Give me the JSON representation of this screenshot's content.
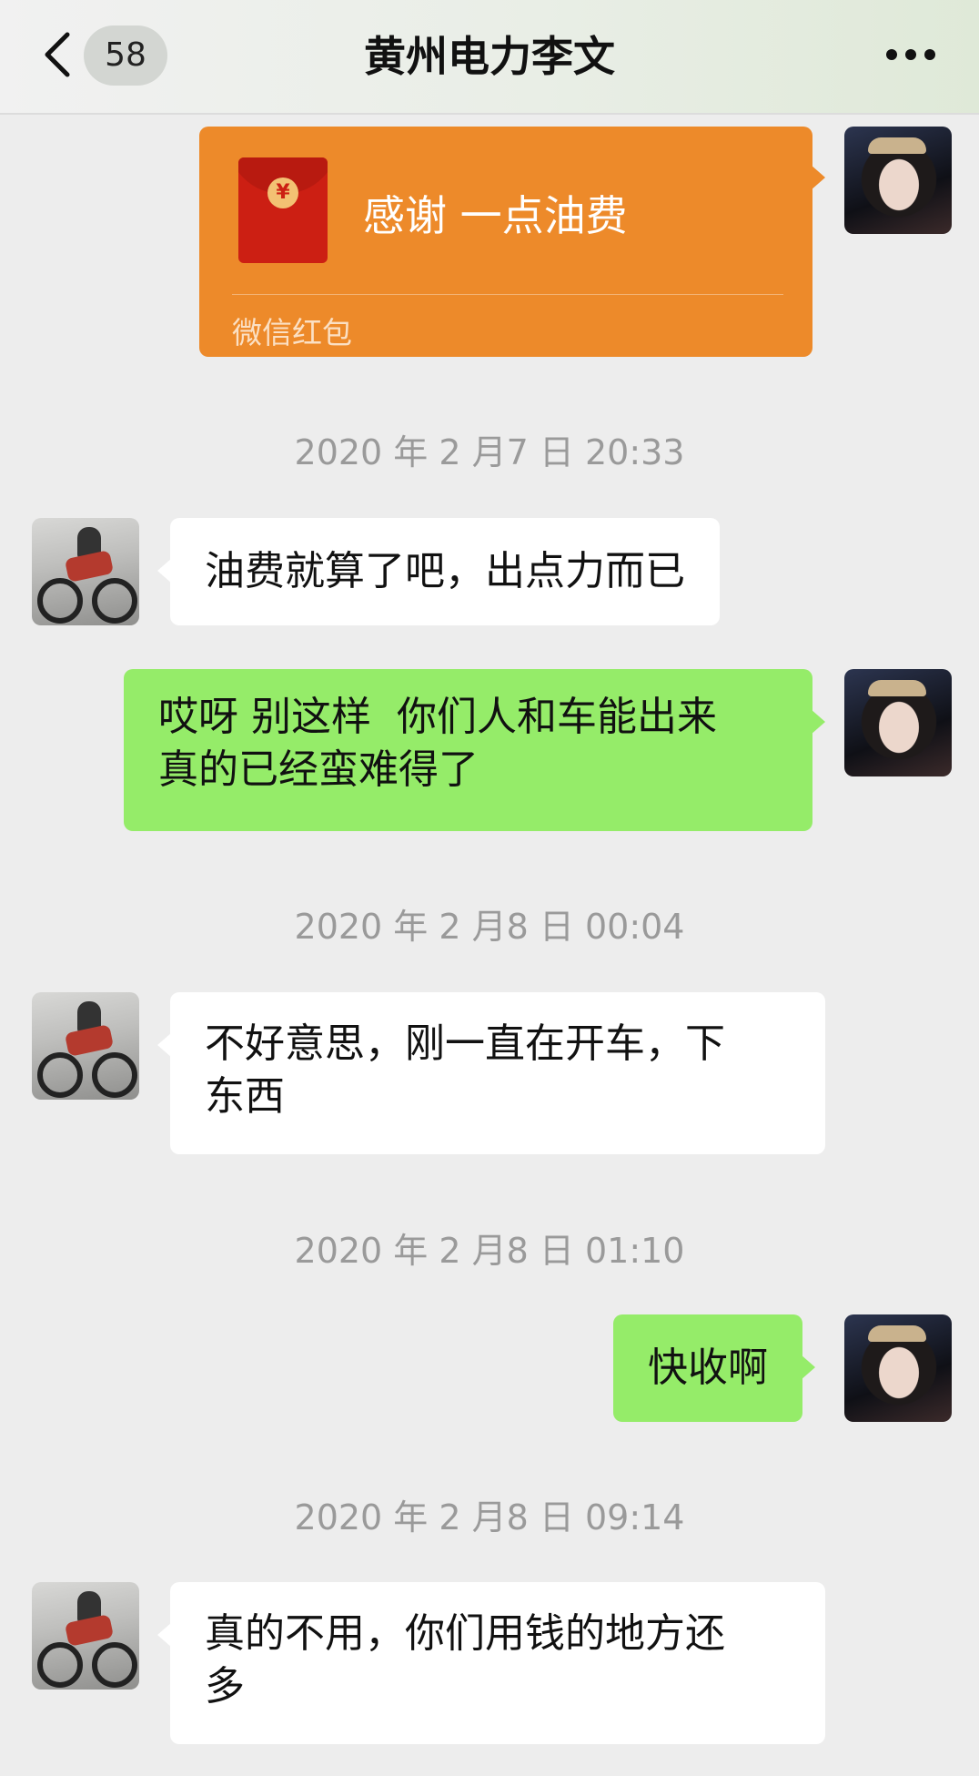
{
  "header": {
    "unread_count": "58",
    "title": "黄州电力李文",
    "back_icon": "chevron-left-icon",
    "more_icon": "ellipsis-icon"
  },
  "colors": {
    "background": "#ededed",
    "sent_bubble": "#95ec69",
    "received_bubble": "#ffffff",
    "red_packet": "#ed8a2a",
    "timestamp_text": "#9a9a9a"
  },
  "red_packet": {
    "message": "感谢 一点油费",
    "footer": "微信红包",
    "icon": "red-envelope-icon"
  },
  "timestamps": [
    "2020 年 2 月7 日 20:33",
    "2020 年 2 月8 日 00:04",
    "2020 年 2 月8 日 01:10",
    "2020 年 2 月8 日 09:14"
  ],
  "messages": [
    {
      "side": "received",
      "text": "油费就算了吧，出点力而已"
    },
    {
      "side": "sent",
      "text": "哎呀 别这样  你们人和车能出来\n真的已经蛮难得了"
    },
    {
      "side": "received",
      "text": "不好意思，刚一直在开车，下\n东西"
    },
    {
      "side": "sent",
      "text": "快收啊"
    },
    {
      "side": "received",
      "text": "真的不用，你们用钱的地方还\n多"
    }
  ]
}
